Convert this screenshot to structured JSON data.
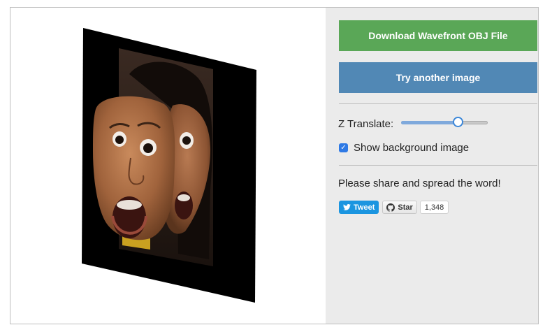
{
  "panel": {
    "download_label": "Download Wavefront OBJ File",
    "try_label": "Try another image",
    "z_translate_label": "Z Translate:",
    "z_translate_value": 0.68,
    "show_background_label": "Show background image",
    "show_background_checked": true,
    "share_text": "Please share and spread the word!"
  },
  "social": {
    "tweet_label": "Tweet",
    "star_label": "Star",
    "star_count": "1,348"
  },
  "colors": {
    "download_button": "#5aa757",
    "try_button": "#5188b5",
    "panel_background": "#ebebeb",
    "tweet_button": "#1b95e0"
  }
}
